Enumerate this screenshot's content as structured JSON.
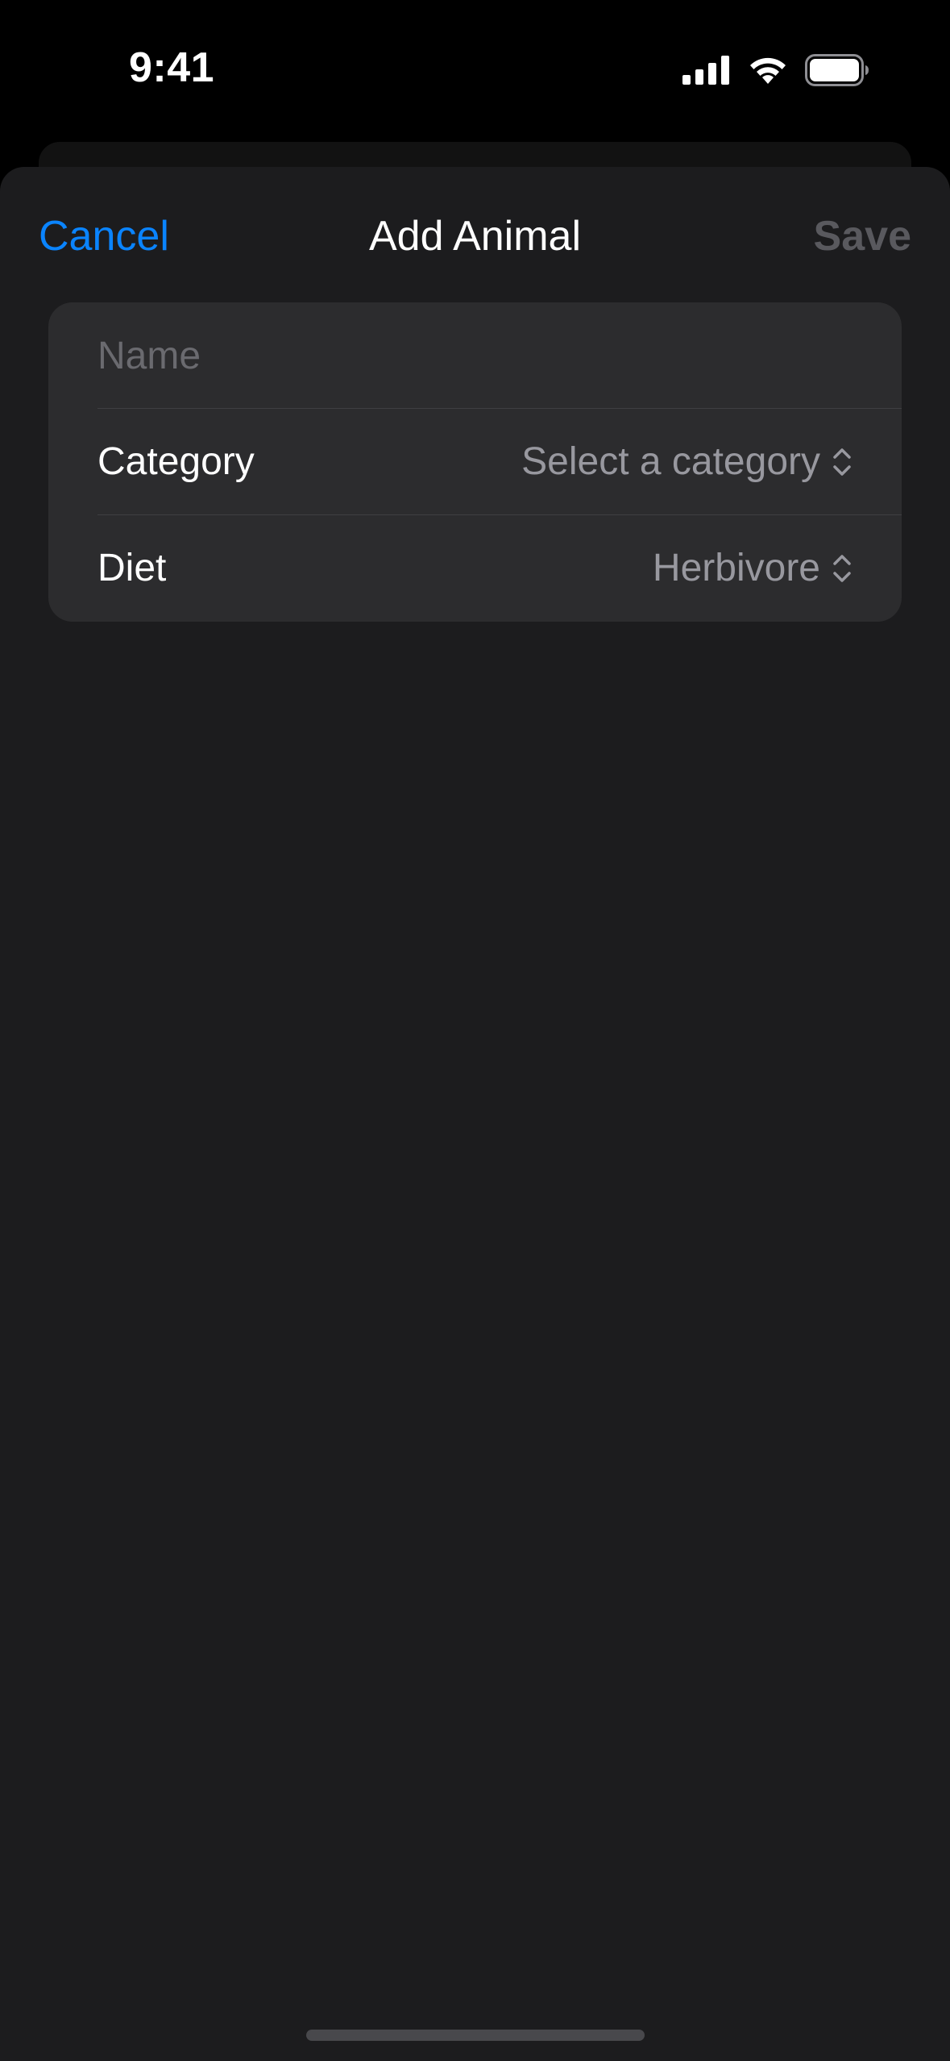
{
  "status_bar": {
    "time": "9:41",
    "icons": [
      "cellular-signal-icon",
      "wifi-icon",
      "battery-icon"
    ]
  },
  "nav": {
    "cancel_label": "Cancel",
    "title": "Add Animal",
    "save_label": "Save"
  },
  "form": {
    "name": {
      "value": "",
      "placeholder": "Name"
    },
    "category": {
      "label": "Category",
      "value": "Select a category"
    },
    "diet": {
      "label": "Diet",
      "value": "Herbivore"
    }
  },
  "colors": {
    "accent": "#0a84ff",
    "sheet_background": "#1c1c1e",
    "group_background": "#2c2c2e",
    "secondary_text": "#98989f",
    "disabled_text": "#59595e"
  }
}
